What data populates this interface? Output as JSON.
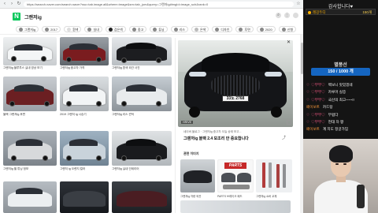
{
  "browser": {
    "url": "https://search.naver.com/search.naver?ssc=tab.image.all&where=image&sm=tab_jum&query=그랜저ig#imgId=image_sch&rank=0",
    "query": "그랜저ig",
    "logo": "N"
  },
  "chips": [
    "그랜저ig",
    "2017",
    "흰색",
    "실내",
    "검은색",
    "중고",
    "튜닝",
    "리스",
    "은색",
    "디자인",
    "후면",
    "2020",
    "신형"
  ],
  "grid_captions": [
    "그랜저ig 블루투스 실내 영상 보기",
    "그랜저ig 중고차 가격",
    "그랜저ig 흰색 외관 사진",
    "블랙 그랜저ig 후면",
    "2019 그랜저 ig 시승기",
    "그랜저ig 리스 견적",
    "그랜저ig 휠 튜닝 정보",
    "그랜저 ig 오렌지 컬러",
    "그랜저ig 실내 인테리어",
    "그랜저ig 가격표 총정리"
  ],
  "detail": {
    "plate": "33노 2768",
    "source": "네이버 블로그 · 그랜저ig 중고차 오늘 상태 보고...",
    "title": "그랜저ig 블랙 2.4 모조리 안 중요합니다",
    "badge": "HRIVE",
    "related_label": "관련 이미지",
    "related": [
      {
        "caption": "그랜저ig 차량 외관"
      },
      {
        "caption": "PARTS 브레이크 패드"
      },
      {
        "caption": "그랜저ig 쇼바 교체"
      }
    ],
    "parts_text": "PARTS"
  },
  "overlay": {
    "mission_title": "감사합니다♥",
    "mission_name": "레깅두디",
    "mission_count": "150개",
    "list_title": "별풍선",
    "gauge_text": "150 / 1000 개",
    "items": [
      {
        "tier": "♡부부♡",
        "tag": "",
        "text": "백보니 맛있겠네"
      },
      {
        "tier": "♡부부♡",
        "tag": "",
        "text": "카루머 실증"
      },
      {
        "tier": "♡부부♡",
        "tag": "",
        "text": "국산의 최고~~~!!"
      },
      {
        "tier": "",
        "tag": "페이보트",
        "text": "카드탕"
      },
      {
        "tier": "♡부부♡",
        "tag": "",
        "text": "부럽다"
      },
      {
        "tier": "♡부부♡",
        "tag": "",
        "text": "현대 차 짱"
      },
      {
        "tier": "",
        "tag": "페이보트",
        "text": "계 지도 정글가임"
      }
    ]
  }
}
